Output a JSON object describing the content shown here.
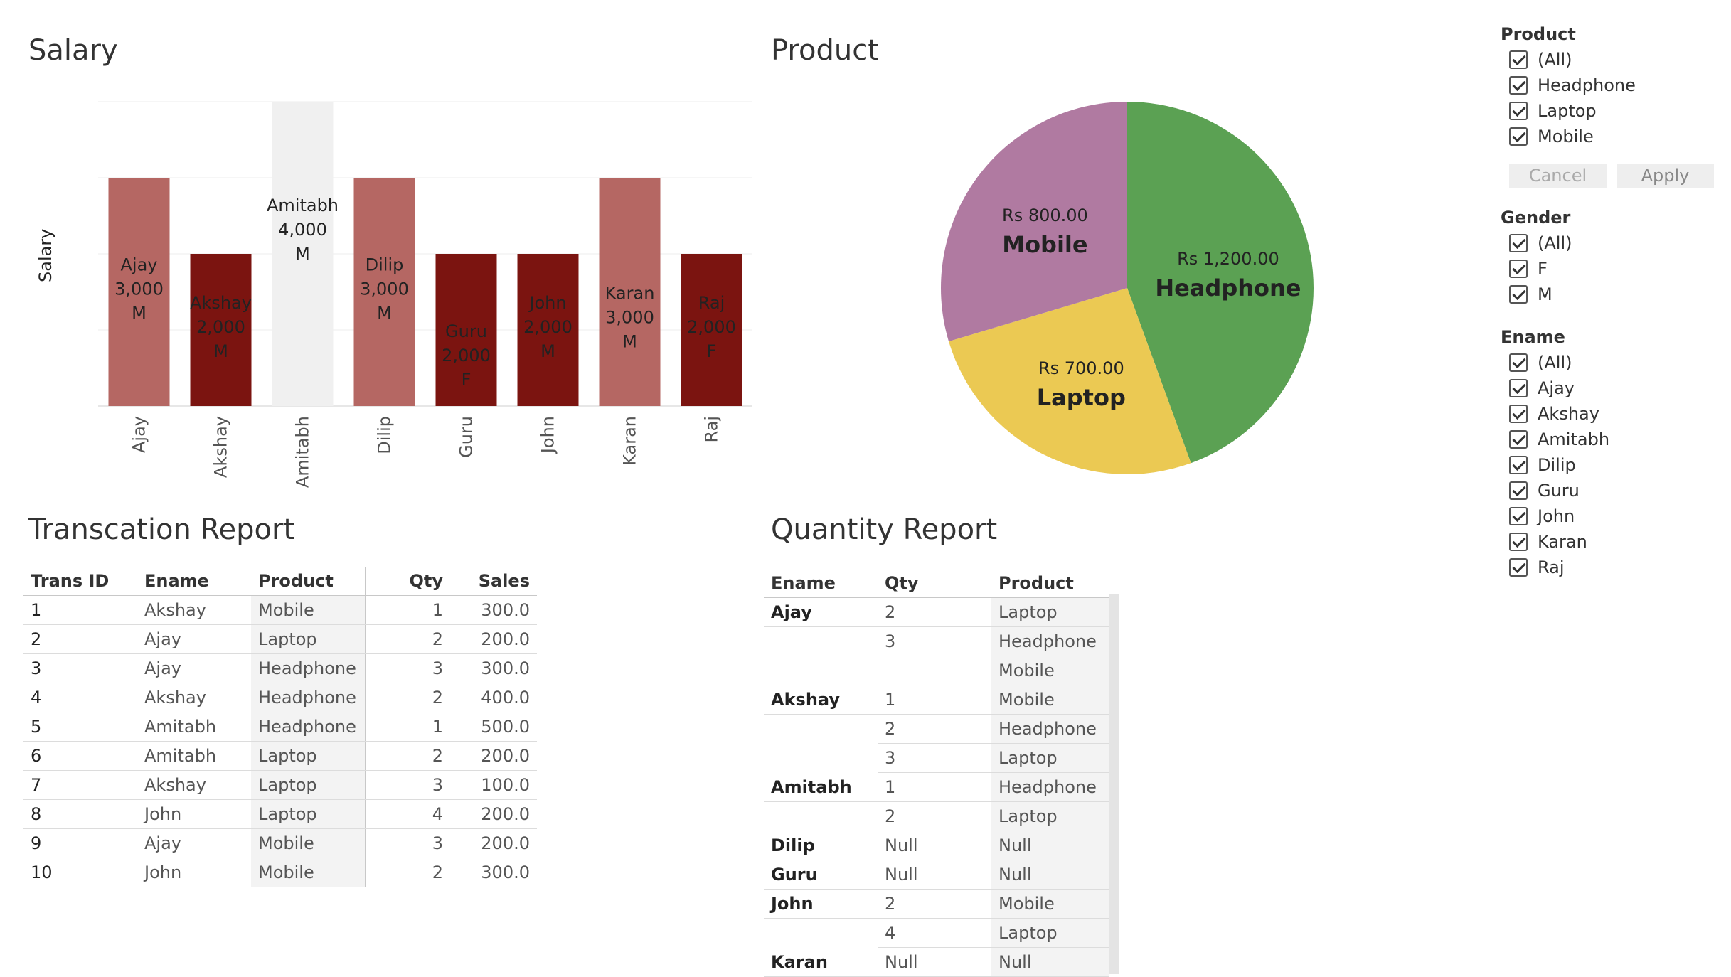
{
  "salary": {
    "title": "Salary",
    "y_axis_label": "Salary"
  },
  "product": {
    "title": "Product"
  },
  "transaction_report": {
    "title": "Transcation Report",
    "columns": [
      "Trans ID",
      "Ename",
      "Product",
      "Qty",
      "Sales"
    ],
    "rows": [
      [
        "1",
        "Akshay",
        "Mobile",
        "1",
        "300.0"
      ],
      [
        "2",
        "Ajay",
        "Laptop",
        "2",
        "200.0"
      ],
      [
        "3",
        "Ajay",
        "Headphone",
        "3",
        "300.0"
      ],
      [
        "4",
        "Akshay",
        "Headphone",
        "2",
        "400.0"
      ],
      [
        "5",
        "Amitabh",
        "Headphone",
        "1",
        "500.0"
      ],
      [
        "6",
        "Amitabh",
        "Laptop",
        "2",
        "200.0"
      ],
      [
        "7",
        "Akshay",
        "Laptop",
        "3",
        "100.0"
      ],
      [
        "8",
        "John",
        "Laptop",
        "4",
        "200.0"
      ],
      [
        "9",
        "Ajay",
        "Mobile",
        "3",
        "200.0"
      ],
      [
        "10",
        "John",
        "Mobile",
        "2",
        "300.0"
      ]
    ]
  },
  "quantity_report": {
    "title": "Quantity Report",
    "columns": [
      "Ename",
      "Qty",
      "Product"
    ],
    "rows": [
      [
        "Ajay",
        "2",
        "Laptop"
      ],
      [
        "",
        "3",
        "Headphone"
      ],
      [
        "",
        "",
        "Mobile"
      ],
      [
        "Akshay",
        "1",
        "Mobile"
      ],
      [
        "",
        "2",
        "Headphone"
      ],
      [
        "",
        "3",
        "Laptop"
      ],
      [
        "Amitabh",
        "1",
        "Headphone"
      ],
      [
        "",
        "2",
        "Laptop"
      ],
      [
        "Dilip",
        "Null",
        "Null"
      ],
      [
        "Guru",
        "Null",
        "Null"
      ],
      [
        "John",
        "2",
        "Mobile"
      ],
      [
        "",
        "4",
        "Laptop"
      ],
      [
        "Karan",
        "Null",
        "Null"
      ]
    ]
  },
  "filters": {
    "product": {
      "title": "Product",
      "items": [
        "(All)",
        "Headphone",
        "Laptop",
        "Mobile"
      ],
      "cancel": "Cancel",
      "apply": "Apply"
    },
    "gender": {
      "title": "Gender",
      "items": [
        "(All)",
        "F",
        "M"
      ]
    },
    "ename": {
      "title": "Ename",
      "items": [
        "(All)",
        "Ajay",
        "Akshay",
        "Amitabh",
        "Dilip",
        "Guru",
        "John",
        "Karan",
        "Raj"
      ]
    }
  },
  "colors": {
    "bar_male": "#b56763",
    "bar_female": "#7b1410",
    "bar_highlight": "#f0f0f0",
    "pie_headphone": "#5ba153",
    "pie_laptop": "#ebc953",
    "pie_mobile": "#b07aa1"
  },
  "chart_data": [
    {
      "type": "bar",
      "title": "Salary",
      "ylabel": "Salary",
      "categories": [
        "Ajay",
        "Akshay",
        "Amitabh",
        "Dilip",
        "Guru",
        "John",
        "Karan",
        "Raj"
      ],
      "values": [
        3000,
        2000,
        4000,
        3000,
        2000,
        2000,
        3000,
        2000
      ],
      "value_labels": [
        "3,000",
        "2,000",
        "4,000",
        "3,000",
        "2,000",
        "2,000",
        "3,000",
        "2,000"
      ],
      "gender": [
        "M",
        "M",
        "M",
        "M",
        "F",
        "M",
        "M",
        "F"
      ],
      "highlighted": [
        "Amitabh"
      ],
      "ylim": [
        0,
        4000
      ],
      "grid": true
    },
    {
      "type": "pie",
      "title": "Product",
      "labels": [
        "Headphone",
        "Laptop",
        "Mobile"
      ],
      "values": [
        1200,
        700,
        800
      ],
      "value_labels": [
        "Rs 1,200.00",
        "Rs 700.00",
        "Rs 800.00"
      ]
    }
  ]
}
